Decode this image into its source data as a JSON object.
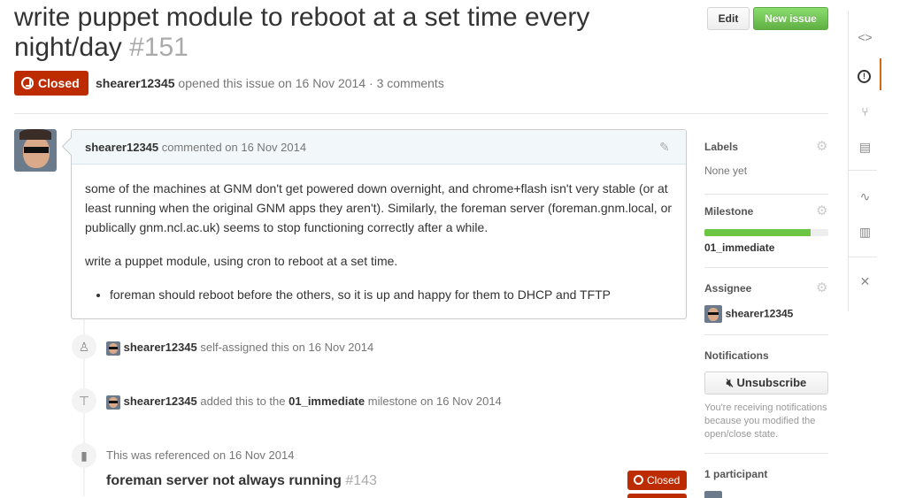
{
  "issue": {
    "title": "write puppet module to reboot at a set time every night/day",
    "number": "#151",
    "state": "Closed",
    "author": "shearer12345",
    "meta_rest": " opened this issue on 16 Nov 2014 · 3 comments"
  },
  "buttons": {
    "edit": "Edit",
    "new_issue": "New issue"
  },
  "comment": {
    "author": "shearer12345",
    "action": " commented on 16 Nov 2014",
    "paragraph1": "some of the machines at GNM don't get powered down overnight, and chrome+flash isn't very stable (or at least running when the original GNM apps they aren't). Similarly, the foreman server (foreman.gnm.local, or publically gnm.ncl.ac.uk) seems to stop functioning correctly after a while.",
    "paragraph2": "write a puppet module, using cron to reboot at a set time.",
    "bullet": "foreman should reboot before the others, so it is up and happy for them to DHCP and TFTP"
  },
  "events": [
    {
      "user": "shearer12345",
      "text": " self-assigned this on 16 Nov 2014"
    },
    {
      "user": "shearer12345",
      "text_pre": " added this to the ",
      "milestone": "01_immediate",
      "text_post": " milestone on 16 Nov 2014"
    }
  ],
  "reference": {
    "text": "This was referenced on 16 Nov 2014",
    "title": "foreman server not always running",
    "number": "#143",
    "state": "Closed"
  },
  "sidebar": {
    "labels": {
      "heading": "Labels",
      "value": "None yet"
    },
    "milestone": {
      "heading": "Milestone",
      "name": "01_immediate",
      "progress": 0.86
    },
    "assignee": {
      "heading": "Assignee",
      "user": "shearer12345"
    },
    "notifications": {
      "heading": "Notifications",
      "button": "Unsubscribe",
      "note": "You're receiving notifications because you modified the open/close state."
    },
    "participants": {
      "heading": "1 participant"
    }
  },
  "colors": {
    "closed": "#bd2c00",
    "new_issue": "#6cc644",
    "accent": "#d26911"
  }
}
